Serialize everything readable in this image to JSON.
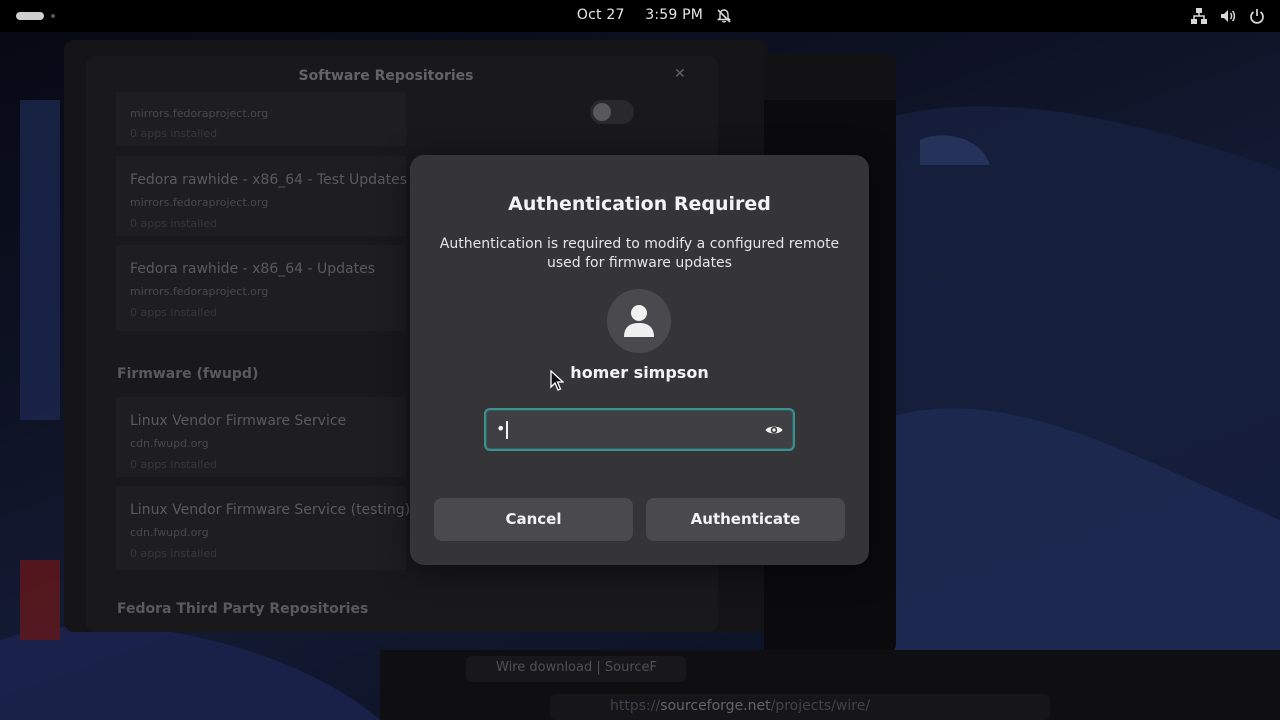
{
  "topbar": {
    "date": "Oct 27",
    "time": "3:59 PM",
    "icons": [
      "notifications-disabled-icon",
      "network-wired-icon",
      "volume-icon",
      "power-icon"
    ]
  },
  "repositories_window": {
    "title": "Software Repositories",
    "repos": [
      {
        "name": "",
        "host": "mirrors.fedoraproject.org",
        "apps": "0 apps installed"
      },
      {
        "name": "Fedora rawhide - x86_64 - Test Updates",
        "host": "mirrors.fedoraproject.org",
        "apps": "0 apps installed"
      },
      {
        "name": "Fedora rawhide - x86_64 - Updates",
        "host": "mirrors.fedoraproject.org",
        "apps": "0 apps installed"
      }
    ],
    "firmware_section": "Firmware (fwupd)",
    "firmware_repos": [
      {
        "name": "Linux Vendor Firmware Service",
        "host": "cdn.fwupd.org",
        "apps": "0 apps installed"
      },
      {
        "name": "Linux Vendor Firmware Service (testing)",
        "host": "cdn.fwupd.org",
        "apps": "0 apps installed"
      }
    ],
    "third_party_section": "Fedora Third Party Repositories"
  },
  "browser": {
    "tab_title": "Wire download | SourceF",
    "url_prefix": "https://",
    "url_domain": "sourceforge.net",
    "url_path": "/projects/wire/"
  },
  "auth_dialog": {
    "title": "Authentication Required",
    "message": "Authentication is required to modify a configured remote used for firmware updates",
    "user_name": "homer simpson",
    "password_value": "•",
    "cancel_label": "Cancel",
    "authenticate_label": "Authenticate"
  },
  "colors": {
    "accent_focus": "#3f8f8d",
    "dialog_bg": "#353538",
    "button_bg": "#4a4a4d"
  }
}
